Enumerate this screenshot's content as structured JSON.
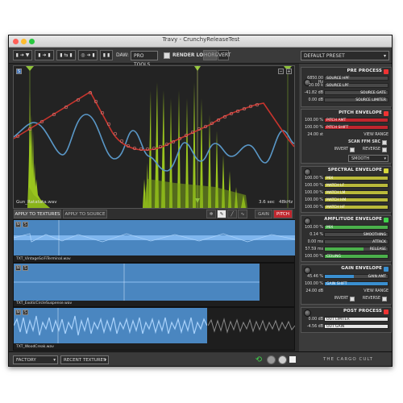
{
  "window": {
    "title": "Travy - CrunchyReleaseTest"
  },
  "toolbar": {
    "daw_label": "DAW:",
    "daw_value": "PRO TOOLS",
    "render_loops_label": "RENDER LOOPS",
    "horiz_label": "HORIZ",
    "vert_label": "VERT",
    "preset_value": "DEFAULT PRESET"
  },
  "waveform": {
    "s_label": "S",
    "filename": "Gun_Ratatata.wav",
    "duration": "3.6 sec",
    "samplerate": "48kHz"
  },
  "tabs": {
    "apply_textures": "APPLY TO TEXTURES",
    "apply_source": "APPLY TO SOURCE",
    "gain": "GAIN",
    "pitch": "PITCH"
  },
  "textures": [
    {
      "m": "M",
      "s": "S",
      "label": "TXT_VintageSciFiTerminal.wav"
    },
    {
      "m": "M",
      "s": "S",
      "label": "TXT_ExoticCircleSuspense.wav"
    },
    {
      "m": "M",
      "s": "S",
      "label": "TXT_WoodCreak.wav"
    }
  ],
  "bottom": {
    "factory_textures": "FACTORY TEXTURES",
    "recent_textures": "RECENT TEXTURES",
    "brand": "THE CARGO CULT"
  },
  "pre_process": {
    "title": "PRE PROCESS",
    "rows": [
      {
        "value": "6850.00 Hz",
        "label": "SOURCE HPF"
      },
      {
        "value": "20.00 k",
        "label": "SOURCE LPF"
      },
      {
        "value": "-41.82 dB",
        "label": "SOURCE GATE"
      },
      {
        "value": "0.00 dB",
        "label": "SOURCE LIMITER"
      }
    ]
  },
  "pitch_envelope": {
    "title": "PITCH ENVELOPE",
    "rows": [
      {
        "value": "100.00 %",
        "label": "PITCH AMT",
        "fill": 1.0,
        "color": "#c0262e"
      },
      {
        "value": "100.00 %",
        "label": "PITCH SHIFT",
        "fill": 1.0,
        "color": "#c0262e"
      }
    ],
    "view_range_value": "24.00 st",
    "view_range_label": "VIEW RANGE",
    "scan_label": "SCAN FFM SRC",
    "invert_label": "INVERT",
    "reverse_label": "REVERSE",
    "smooth_value": "SMOOTH"
  },
  "spectral_envelope": {
    "title": "SPECTRAL ENVELOPE",
    "rows": [
      {
        "value": "100.00 %",
        "label": "MIX",
        "fill": 1.0
      },
      {
        "value": "100.00 %",
        "label": "MATCH LF",
        "fill": 1.0
      },
      {
        "value": "100.00 %",
        "label": "MATCH LM",
        "fill": 1.0
      },
      {
        "value": "100.00 %",
        "label": "MATCH HM",
        "fill": 1.0
      },
      {
        "value": "100.00 %",
        "label": "MATCH HF",
        "fill": 1.0
      }
    ],
    "color": "#b9b93a"
  },
  "amplitude_envelope": {
    "title": "AMPLITUDE ENVELOPE",
    "rows": [
      {
        "value": "100.00 %",
        "label": "MIX",
        "fill": 1.0,
        "label_pos": "left"
      },
      {
        "value": "0.14 %",
        "label": "SMOOTHING",
        "fill": 0.0,
        "label_pos": "right"
      },
      {
        "value": "0.00 ms",
        "label": "ATTACK",
        "fill": 0.0,
        "label_pos": "right"
      },
      {
        "value": "57.59 ms",
        "label": "RELEASE",
        "fill": 0.6,
        "label_pos": "right"
      },
      {
        "value": "100.00 %",
        "label": "CEILING",
        "fill": 1.0,
        "label_pos": "left"
      }
    ],
    "color": "#4bb04b"
  },
  "gain_envelope": {
    "title": "GAIN ENVELOPE",
    "rows": [
      {
        "value": "45.46 %",
        "label": "GAIN AMT",
        "fill": 0.45,
        "label_pos": "right"
      },
      {
        "value": "100.00 %",
        "label": "GAIN SHIFT",
        "fill": 1.0,
        "label_pos": "left"
      }
    ],
    "view_range_value": "24.00 dB",
    "view_range_label": "VIEW RANGE",
    "invert_label": "INVERT",
    "reverse_label": "REVERSE",
    "color": "#3a8fd0"
  },
  "post_process": {
    "title": "POST PROCESS",
    "rows": [
      {
        "value": "0.00 dB",
        "label": "OUT LIMITER",
        "fill": 1.0
      },
      {
        "value": "-4.56 dB",
        "label": "OUT GAIN",
        "fill": 1.0
      }
    ]
  },
  "colors": {
    "accent_green": "#3fd14a",
    "accent_red": "#d32f2f",
    "wave_green": "#a6d61e",
    "wave_blue": "#5a98c8",
    "env_red": "#c8342d"
  }
}
